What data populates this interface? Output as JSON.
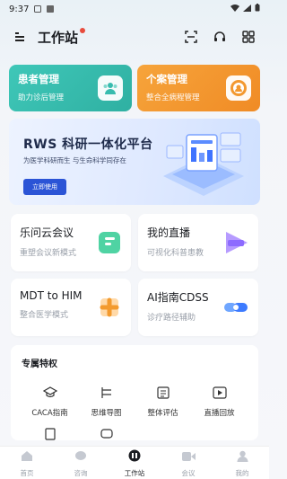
{
  "status_bar": {
    "time": "9:37"
  },
  "header": {
    "title": "工作站",
    "menu_icon": "menu-icon",
    "actions": [
      "scan-icon",
      "headset-icon",
      "grid-icon"
    ]
  },
  "top_cards": [
    {
      "title": "患者管理",
      "subtitle": "助力诊后管理",
      "icon": "patients-icon",
      "color": "#37bcae"
    },
    {
      "title": "个案管理",
      "subtitle": "整合全病程管理",
      "icon": "case-badge-icon",
      "color": "#f3982f"
    }
  ],
  "banner": {
    "title": "RWS 科研一体化平台",
    "subtitle": "为医学科研而生  与生命科学同存在",
    "button": "立即使用"
  },
  "tiles": [
    {
      "title": "乐问云会议",
      "subtitle": "重塑会议新模式",
      "icon": "meeting-icon"
    },
    {
      "title": "我的直播",
      "subtitle": "可视化科普患教",
      "icon": "live-icon"
    },
    {
      "title": "MDT to HIM",
      "subtitle": "整合医学模式",
      "icon": "mdt-icon"
    },
    {
      "title": "AI指南CDSS",
      "subtitle": "诊疗路径辅助",
      "icon": "cdss-icon"
    }
  ],
  "privileges": {
    "heading": "专属特权",
    "items": [
      {
        "label": "CACA指南",
        "icon": "graduation-cap-icon"
      },
      {
        "label": "思维导图",
        "icon": "mind-map-icon"
      },
      {
        "label": "整体评估",
        "icon": "assessment-icon"
      },
      {
        "label": "直播回放",
        "icon": "playback-icon"
      }
    ]
  },
  "tabbar": [
    {
      "label": "首页",
      "icon": "home-icon",
      "active": false
    },
    {
      "label": "咨询",
      "icon": "chat-icon",
      "active": false
    },
    {
      "label": "工作站",
      "icon": "workstation-icon",
      "active": true
    },
    {
      "label": "会议",
      "icon": "video-icon",
      "active": false
    },
    {
      "label": "我的",
      "icon": "profile-icon",
      "active": false
    }
  ],
  "colors": {
    "accent": "#2b54d6",
    "teal": "#37bcae",
    "orange": "#f3982f",
    "badge_dot": "#e84c3d"
  }
}
